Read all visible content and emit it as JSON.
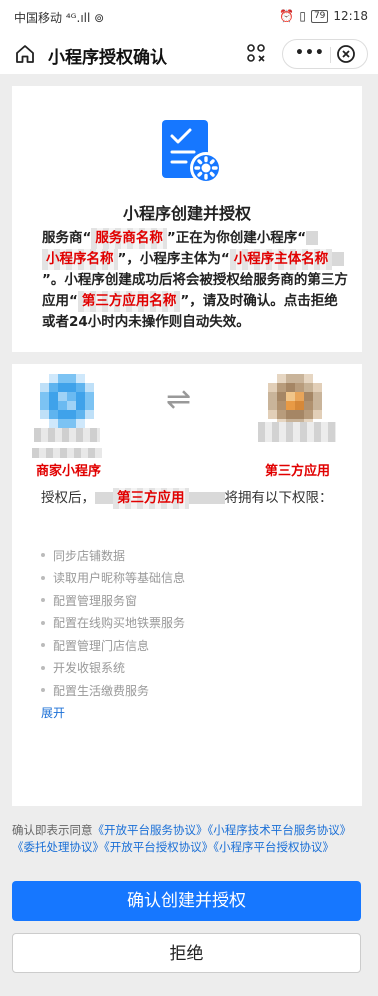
{
  "statusbar": {
    "carrier": "中国移动",
    "signal": "⁴ᴳ.ıll ⊚",
    "battery": "79",
    "time": "12:18"
  },
  "navbar": {
    "title": "小程序授权确认",
    "more": "•••"
  },
  "auth": {
    "title": "小程序创建并授权",
    "desc_1": "服务商“",
    "tag_provider": "服务商名称",
    "desc_2": "”正在为你创建小程序“",
    "tag_miniapp": "小程序名称",
    "desc_3": "”，小程序主体为“",
    "tag_subject": "小程序主体名称",
    "desc_4": "”。小程序创建成功后将会被授权给服务商的第三方应用“",
    "tag_thirdparty": "第三方应用名称",
    "desc_5": "”，请及时确认。点击拒绝或者24小时内未操作则自动失效。"
  },
  "parties": {
    "left_label": "商家小程序",
    "right_label": "第三方应用",
    "arrow": "⇌"
  },
  "permissions": {
    "intro_1": "授权后，",
    "intro_tag": "第三方应用",
    "intro_2": "将拥有以下权限：",
    "items": [
      "同步店铺数据",
      "读取用户昵称等基础信息",
      "配置管理服务窗",
      "配置在线购买地铁票服务",
      "配置管理门店信息",
      "开发收银系统",
      "配置生活缴费服务"
    ],
    "expand": "展开"
  },
  "agreement": {
    "prefix": "确认即表示同意",
    "links": [
      "《开放平台服务协议》",
      "《小程序技术平台服务协议》",
      "《委托处理协议》",
      "《开放平台授权协议》",
      "《小程序平台授权协议》"
    ]
  },
  "buttons": {
    "confirm": "确认创建并授权",
    "reject": "拒绝"
  },
  "colors": {
    "primary": "#1677ff",
    "link": "#1a6fd6",
    "highlight": "#e10000"
  }
}
